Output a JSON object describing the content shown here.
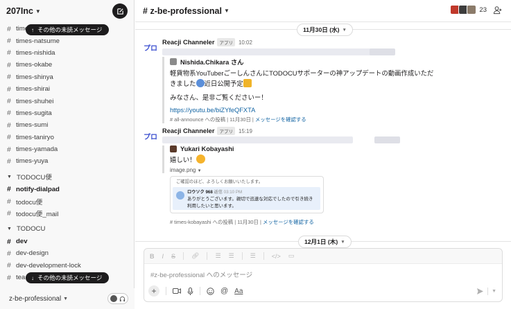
{
  "workspace": {
    "name": "207Inc"
  },
  "sidebar": {
    "channels_top": [
      "times-m",
      "times-natsume",
      "times-nishida",
      "times-okabe",
      "times-shinya",
      "times-shirai",
      "times-shuhei",
      "times-sugita",
      "times-sumi",
      "times-taniryo",
      "times-yamada",
      "times-yuya"
    ],
    "sections": [
      {
        "label": "TODOCU便",
        "items": [
          {
            "name": "notify-dialpad",
            "bold": true
          },
          {
            "name": "todocu便",
            "bold": false
          },
          {
            "name": "todocu便_mail",
            "bold": false
          }
        ]
      },
      {
        "label": "TODOCU",
        "items": [
          {
            "name": "dev",
            "bold": true
          },
          {
            "name": "dev-design",
            "bold": false
          },
          {
            "name": "dev-development-lock",
            "bold": false
          },
          {
            "name": "tea",
            "bold": false
          }
        ]
      }
    ],
    "unread_top": "その他の未読メッセージ",
    "unread_bottom": "その他の未読メッセージ",
    "footer_channel": "z-be-professional"
  },
  "header": {
    "channel": "z-be-professional",
    "member_count": "23"
  },
  "messages": {
    "date1": "11月30日 (水)",
    "date2": "12月1日 (木)",
    "m1": {
      "avatar_text": "プロ",
      "sender": "Reacji Channeler",
      "badge": "アプリ",
      "time": "10:02",
      "quote_author": "Nishida.Chikara さん",
      "line1": "軽貨物系YouTuberごーしんさんにTODOCUサポーターの神アップデートの動画作成いただ",
      "line2": "きました",
      "line2b": "近日公開予定",
      "line3": "みなさん、是非ご覧くださいー！",
      "link": "https://youtu.be/biZYfeQFXTA",
      "meta_channel": "# all-announce への投稿",
      "meta_date": "11月30日",
      "meta_link": "メッセージを確認する"
    },
    "m2": {
      "avatar_text": "プロ",
      "sender": "Reacji Channeler",
      "badge": "アプリ",
      "time": "15:19",
      "quote_author": "Yukari Kobayashi",
      "text": "嬉しい！",
      "file": "image.png",
      "img_line1": "ご確認のほど、よろしくお願いいたします。",
      "img_user": "ロウソク 968",
      "img_user_tag": "返信",
      "img_user_time": "03:10 PM",
      "img_line2": "ありがとうございます。親切で迅速な対応でしたので引き続き",
      "img_line3": "利用したいと思います。",
      "meta_channel": "# times-kobayashi への投稿",
      "meta_date": "11月30日",
      "meta_link": "メッセージを確認する"
    }
  },
  "composer": {
    "placeholder": "#z-be-professional へのメッセージ"
  },
  "colors": {
    "link": "#1264a3",
    "dark": "#1d1c1d",
    "app_avatar": "#3a4ecf"
  }
}
